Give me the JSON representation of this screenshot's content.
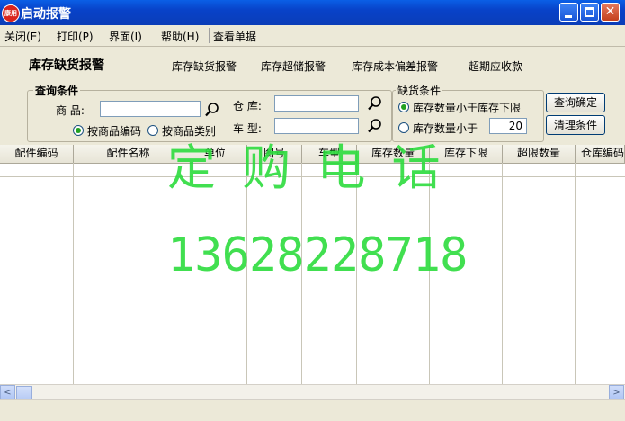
{
  "window": {
    "title": "启动报警",
    "app_icon_text": "康用"
  },
  "menu": [
    "关闭(E)",
    "打印(P)",
    "界面(I)",
    "帮助(H)",
    "查看单据"
  ],
  "header": {
    "section_title": "库存缺货报警",
    "tabs": [
      "库存缺货报警",
      "库存超储报警",
      "库存成本偏差报警",
      "超期应收款"
    ]
  },
  "query": {
    "legend": "查询条件",
    "product_label": "商  品:",
    "product_value": "",
    "radio_by_code": "按商品编码",
    "radio_by_category": "按商品类别",
    "warehouse_label": "仓  库:",
    "warehouse_value": "",
    "vehicle_label": "车  型:",
    "vehicle_value": ""
  },
  "shortage": {
    "legend": "缺货条件",
    "option_below_min": "库存数量小于库存下限",
    "option_less_than": "库存数量小于",
    "threshold": "20"
  },
  "buttons": {
    "confirm": "查询确定",
    "clear": "清理条件"
  },
  "table": {
    "columns": [
      "配件编码",
      "配件名称",
      "单位",
      "图号",
      "车型",
      "库存数量",
      "库存下限",
      "超限数量",
      "仓库编码"
    ]
  },
  "scroll": {
    "left_arrow": "<",
    "right_arrow": ">"
  },
  "watermark": {
    "line1": "定 购 电 话",
    "line2": "13628228718"
  },
  "colors": {
    "title_blue": "#0842C8",
    "watermark_green": "#2DDC3E",
    "radio_dot": "#21A121"
  }
}
